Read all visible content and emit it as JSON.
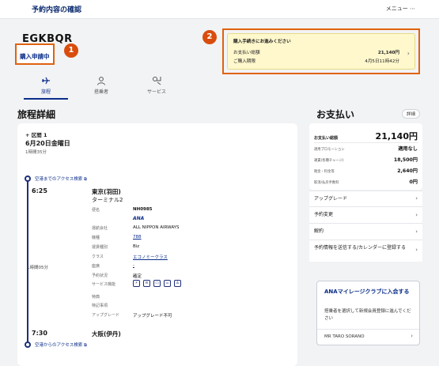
{
  "header": {
    "title": "予約内容の確認",
    "menu_label": "メニュー ⋯"
  },
  "booking": {
    "code": "EGKBQR",
    "status": "購入申請中"
  },
  "callouts": [
    "1",
    "2"
  ],
  "notice": {
    "title": "購入手続きにお進みください",
    "amount_label": "お支払い総額",
    "amount_value": "21,140円",
    "deadline_label": "ご購入期限",
    "deadline_value": "4月5日11時42分"
  },
  "tabs": [
    {
      "label": "旅程",
      "icon": "plane-icon",
      "active": true
    },
    {
      "label": "搭乗者",
      "icon": "person-icon",
      "active": false
    },
    {
      "label": "サービス",
      "icon": "service-icon",
      "active": false
    }
  ],
  "itinerary": {
    "section_title": "旅程詳細",
    "segment_label": "区間 1",
    "date": "6月20日金曜日",
    "total_duration": "1時間35分",
    "access_before": "空港までのアクセス検索",
    "access_after": "空港からのアクセス検索",
    "departure": {
      "time": "6:25",
      "city": "東京(羽田)",
      "terminal": "ターミナル2"
    },
    "arrival": {
      "time": "7:30",
      "city": "大阪(伊丹)"
    },
    "flight_duration": "1時間05分",
    "flight_number": "NH0985",
    "airline_logo_text": "ANA",
    "details": [
      {
        "label": "運航会社",
        "value": "ALL NIPPON AIRWAYS",
        "link": false
      },
      {
        "label": "機種",
        "value": "788",
        "link": true
      },
      {
        "label": "運賃種別",
        "value": "Biz",
        "link": false
      },
      {
        "label": "クラス",
        "value": "エコノミークラス",
        "link": true
      },
      {
        "label": "座席",
        "value": "-",
        "link": true
      },
      {
        "label": "予約状況",
        "value": "確定",
        "link": false
      },
      {
        "label": "サービス機能",
        "value": "",
        "link": false
      },
      {
        "label": "特典",
        "value": "",
        "link": false
      },
      {
        "label": "特記事項",
        "value": "",
        "link": false
      },
      {
        "label": "アップグレード",
        "value": "アップグレード不可",
        "link": false
      }
    ],
    "service_icons": [
      "power-icon",
      "wifi-icon",
      "screen-icon",
      "meal-icon",
      "seat-icon"
    ]
  },
  "payment": {
    "title": "お支払い",
    "detail_button": "詳細",
    "total_label": "お支払い総額",
    "total_value": "21,140円",
    "rows": [
      {
        "label": "適用プロモーション",
        "value": "適用なし"
      },
      {
        "label": "運賃(各種チャージ)",
        "value": "18,500円"
      },
      {
        "label": "税金・料金等",
        "value": "2,640円"
      },
      {
        "label": "取消/払戻手数料",
        "value": "0円"
      }
    ],
    "actions": [
      "アップグレード",
      "予約変更",
      "解約",
      "予約情報を送信する/カレンダーに登録する"
    ]
  },
  "mileage": {
    "title": "ANAマイレージクラブに入会する",
    "description": "搭乗者を選択して新規会員登録に進んでください",
    "member_name": "MR TARO SORANO"
  }
}
